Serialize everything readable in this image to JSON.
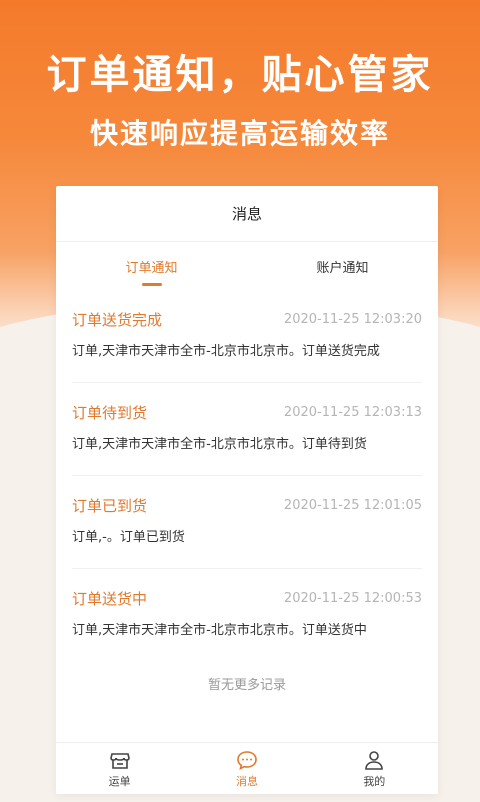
{
  "hero": {
    "title": "订单通知，贴心管家",
    "subtitle": "快速响应提高运输效率"
  },
  "app": {
    "header_title": "消息",
    "tabs": [
      {
        "label": "订单通知",
        "active": true
      },
      {
        "label": "账户通知",
        "active": false
      }
    ],
    "messages": [
      {
        "title": "订单送货完成",
        "time": "2020-11-25 12:03:20",
        "body": "订单,天津市天津市全市-北京市北京市。订单送货完成"
      },
      {
        "title": "订单待到货",
        "time": "2020-11-25 12:03:13",
        "body": "订单,天津市天津市全市-北京市北京市。订单待到货"
      },
      {
        "title": "订单已到货",
        "time": "2020-11-25 12:01:05",
        "body": "订单,-。订单已到货"
      },
      {
        "title": "订单送货中",
        "time": "2020-11-25 12:00:53",
        "body": "订单,天津市天津市全市-北京市北京市。订单送货中"
      }
    ],
    "no_more": "暂无更多记录",
    "bottom_nav": [
      {
        "label": "运单",
        "icon": "shop-icon",
        "active": false
      },
      {
        "label": "消息",
        "icon": "chat-icon",
        "active": true
      },
      {
        "label": "我的",
        "icon": "user-icon",
        "active": false
      }
    ],
    "accent_color": "#e07a2f"
  }
}
